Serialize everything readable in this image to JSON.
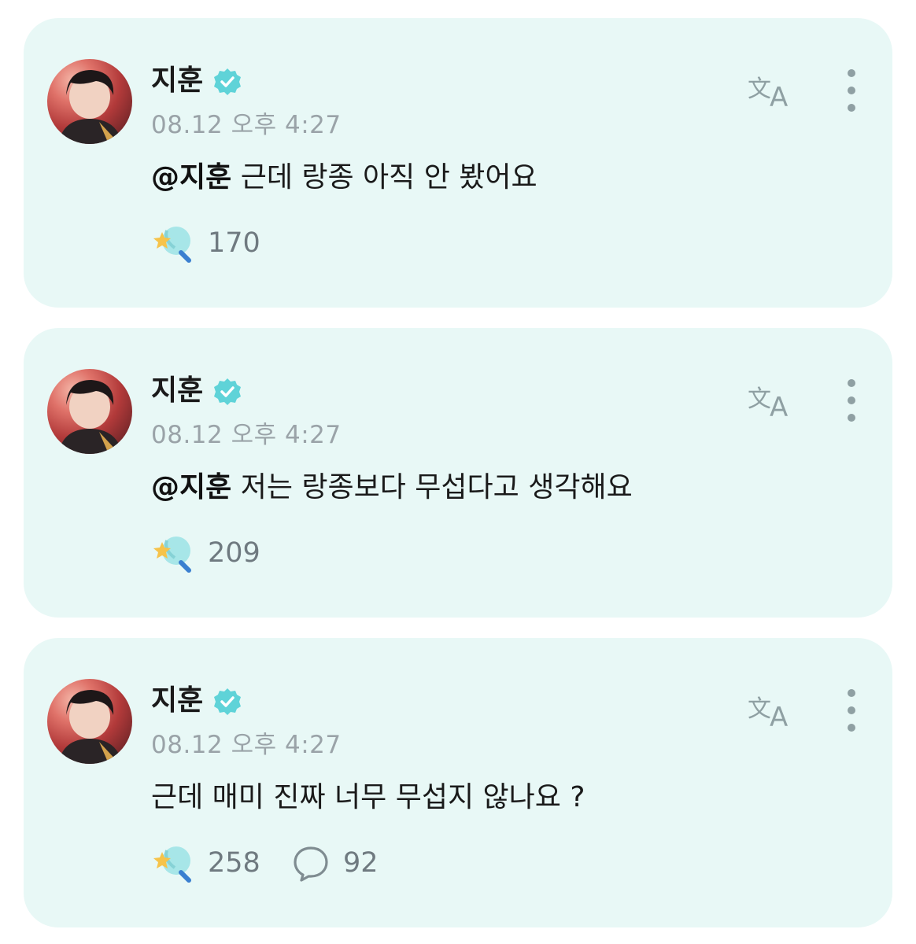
{
  "posts": [
    {
      "author": "지훈",
      "time": "08.12 오후 4:27",
      "mention": "@지훈",
      "message": " 근데 랑종 아직 안 봤어요",
      "reactions": "170",
      "comments": ""
    },
    {
      "author": "지훈",
      "time": "08.12 오후 4:27",
      "mention": "@지훈",
      "message": " 저는 랑종보다 무섭다고 생각해요",
      "reactions": "209",
      "comments": ""
    },
    {
      "author": "지훈",
      "time": "08.12 오후 4:27",
      "mention": "",
      "message": "근데 매미 진짜 너무 무섭지 않나요 ?",
      "reactions": "258",
      "comments": "92"
    }
  ],
  "icons": {
    "verified": "verified-badge-icon",
    "translate": "translate-icon",
    "more": "more-vertical-icon",
    "reaction": "star-bubble-reaction-icon",
    "comment": "comment-bubble-icon"
  },
  "colors": {
    "card_background": "#e8f8f6",
    "verified": "#5fd3d8",
    "muted_text": "#9aa3a8",
    "icon_gray": "#8fa0a3"
  }
}
